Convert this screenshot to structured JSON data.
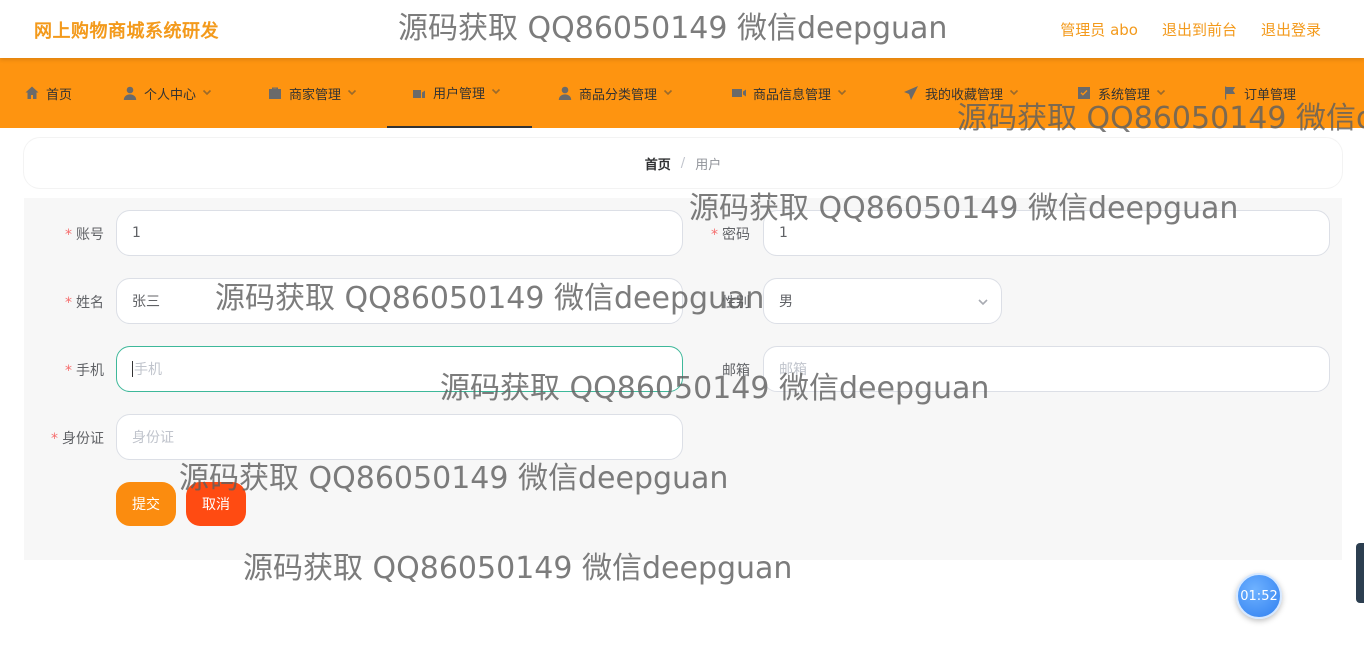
{
  "header": {
    "brand": "网上购物商城系统研发",
    "links": [
      "管理员 abo",
      "退出到前台",
      "退出登录"
    ]
  },
  "nav": {
    "items": [
      {
        "label": "首页",
        "icon": "home-icon"
      },
      {
        "label": "个人中心",
        "icon": "user-icon"
      },
      {
        "label": "商家管理",
        "icon": "shop-icon"
      },
      {
        "label": "用户管理",
        "icon": "users-icon"
      },
      {
        "label": "商品分类管理",
        "icon": "user-icon"
      },
      {
        "label": "商品信息管理",
        "icon": "video-icon"
      },
      {
        "label": "我的收藏管理",
        "icon": "send-icon"
      },
      {
        "label": "系统管理",
        "icon": "settings-icon"
      },
      {
        "label": "订单管理",
        "icon": "flag-icon"
      }
    ],
    "active_index": 3
  },
  "breadcrumb": {
    "home": "首页",
    "separator": "/",
    "current": "用户"
  },
  "form": {
    "account": {
      "label": "账号",
      "value": "1"
    },
    "password": {
      "label": "密码",
      "value": "1"
    },
    "name": {
      "label": "姓名",
      "value": "张三"
    },
    "gender": {
      "label": "性别",
      "value": "男"
    },
    "phone": {
      "label": "手机",
      "placeholder": "手机"
    },
    "email": {
      "label": "邮箱",
      "placeholder": "邮箱"
    },
    "id_card": {
      "label": "身份证",
      "placeholder": "身份证"
    },
    "submit_label": "提交",
    "cancel_label": "取消"
  },
  "colors": {
    "brand": "#f39a1c",
    "nav_bg": "#fe9410",
    "submit": "#fb8c0f",
    "cancel": "#ff4b12",
    "focus": "#3eb89a"
  },
  "watermark": "源码获取 QQ86050149 微信deepguan",
  "timer": "01:52"
}
